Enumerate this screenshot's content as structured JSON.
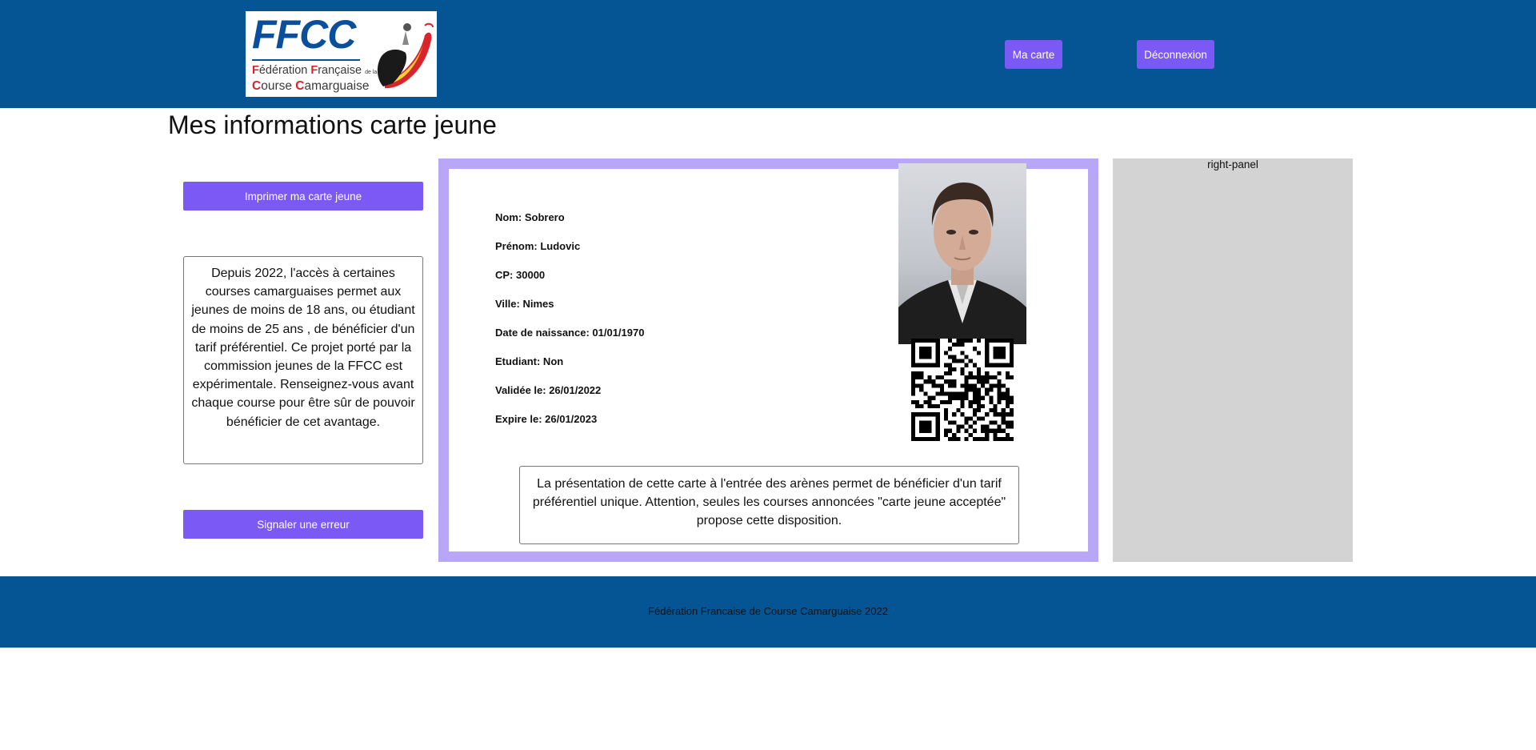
{
  "header": {
    "logo": {
      "wordmark": "FFCC",
      "line1_parts": [
        "F",
        "édération ",
        "F",
        "rançaise ",
        "de la"
      ],
      "line2_parts": [
        "C",
        "ourse ",
        "C",
        "amarguaise"
      ]
    },
    "nav": {
      "card_label": "Ma carte",
      "logout_label": "Déconnexion"
    },
    "brand_colors": {
      "header_bg": "#055594",
      "button_bg": "#7b59f4"
    }
  },
  "page": {
    "title": "Mes informations carte jeune"
  },
  "left_panel": {
    "print_label": "Imprimer ma carte jeune",
    "info_text": "Depuis 2022, l'accès à certaines courses camarguaises permet aux jeunes de moins de 18 ans, ou étudiant de moins de 25 ans , de bénéficier d'un tarif préférentiel. Ce projet porté par la commission jeunes de la FFCC est expérimentale. Renseignez-vous avant chaque course pour être sûr de pouvoir bénéficier de cet avantage.",
    "report_label": "Signaler une erreur"
  },
  "card": {
    "fields": [
      "Nom: Sobrero",
      "Prénom: Ludovic",
      "CP: 30000",
      "Ville: Nimes",
      "Date de naissance: 01/01/1970",
      "Etudiant: Non",
      "Validée le: 26/01/2022",
      "Expire le: 26/01/2023"
    ],
    "frame_color": "#b8a7f6",
    "photo_icon": "portrait-photo",
    "qr_icon": "qr-code",
    "notice": "La présentation de cette carte à l'entrée des arènes permet de bénéficier d'un tarif préférentiel unique. Attention, seules les courses annoncées \"carte jeune acceptée\" propose cette disposition."
  },
  "right_panel": {
    "label": "right-panel"
  },
  "footer": {
    "text": "Fédération Francaise de Course Camarguaise 2022"
  }
}
